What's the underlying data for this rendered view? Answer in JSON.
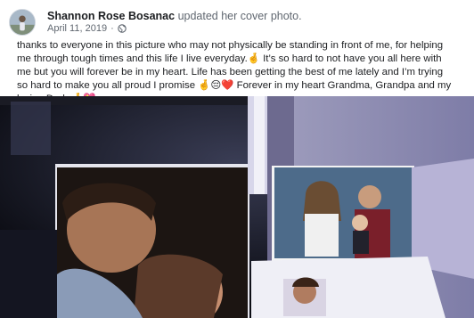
{
  "post": {
    "author": "Shannon Rose Bosanac",
    "action": "updated her cover photo.",
    "date": "April 11, 2019",
    "separator": "·",
    "privacy_icon": "globe-icon",
    "text_lines": [
      "thanks to everyone in this picture who may not physically be standing in front of me, for helping",
      "me through tough times and this life I live everyday.🤞 It’s so hard to not have you all here with",
      "me but you will forever be in my heart. Life has been getting the best of me lately and I’m trying",
      "so hard to make you all proud I promise 🤞😔❤️ Forever in my heart Grandma, Grandpa and my",
      "loving Dad..🤞💝"
    ]
  },
  "colors": {
    "name": "#1c1e21",
    "meta": "#606770",
    "photo_bg": "#0e1016"
  }
}
